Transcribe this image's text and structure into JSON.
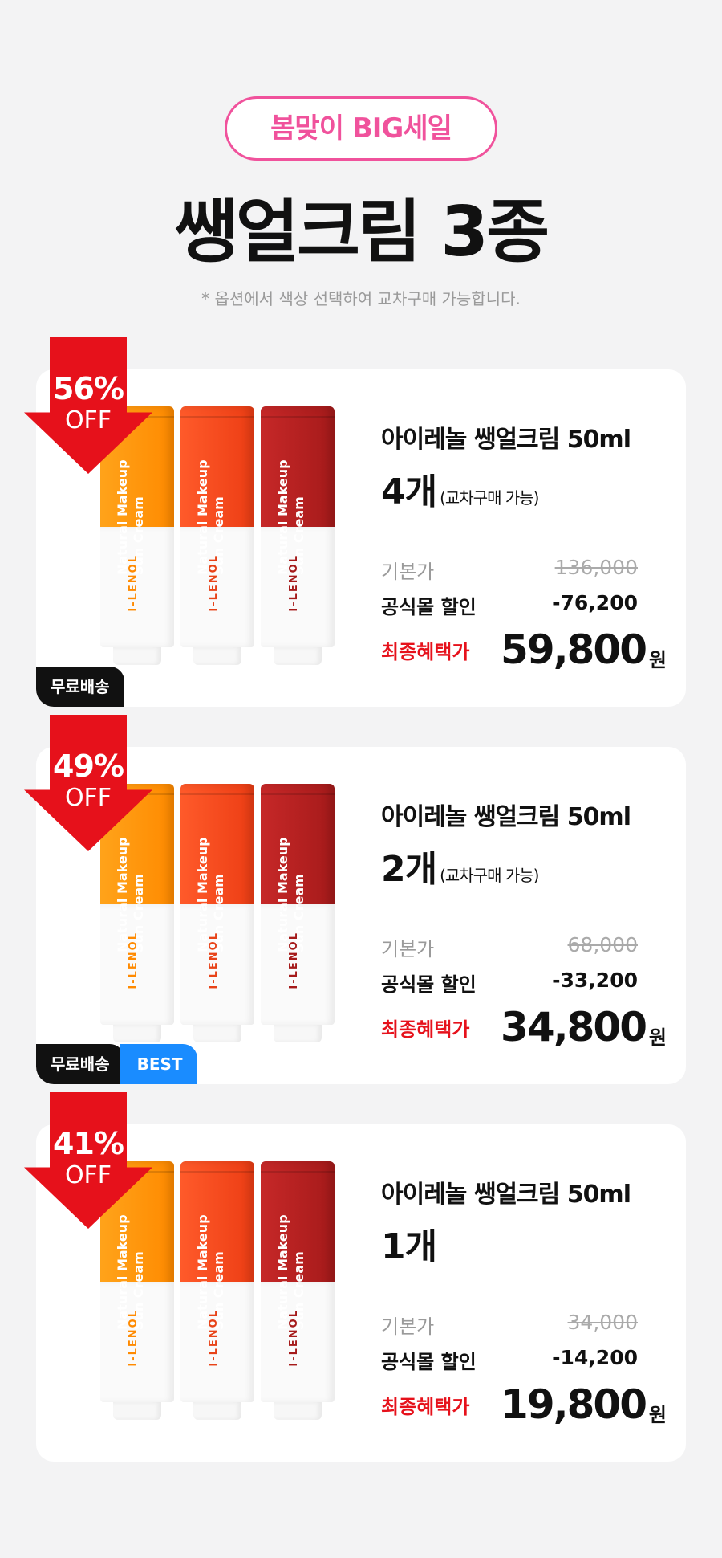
{
  "header": {
    "pill": "봄맞이 BIG세일",
    "headline": "쌩얼크림 3종",
    "note": "* 옵션에서 색상 선택하여 교차구매 가능합니다."
  },
  "tube_texts": {
    "label": "Natural Makeup Sun Cream",
    "brand": "I-LENOL"
  },
  "products": [
    {
      "discount_pct": "56%",
      "discount_off": "OFF",
      "tag_free": "무료배송",
      "tag_best": "",
      "name": "아이레놀 쌩얼크림 50ml",
      "qty": "4개",
      "qty_note": "(교차구매 가능)",
      "base_label": "기본가",
      "base_price": "136,000",
      "discount_label": "공식몰 할인",
      "discount_amount": "-76,200",
      "final_label": "최종혜택가",
      "final_price": "59,800",
      "unit": "원"
    },
    {
      "discount_pct": "49%",
      "discount_off": "OFF",
      "tag_free": "무료배송",
      "tag_best": "BEST",
      "name": "아이레놀 쌩얼크림 50ml",
      "qty": "2개",
      "qty_note": "(교차구매 가능)",
      "base_label": "기본가",
      "base_price": "68,000",
      "discount_label": "공식몰 할인",
      "discount_amount": "-33,200",
      "final_label": "최종혜택가",
      "final_price": "34,800",
      "unit": "원"
    },
    {
      "discount_pct": "41%",
      "discount_off": "OFF",
      "tag_free": "",
      "tag_best": "",
      "name": "아이레놀 쌩얼크림 50ml",
      "qty": "1개",
      "qty_note": "",
      "base_label": "기본가",
      "base_price": "34,000",
      "discount_label": "공식몰 할인",
      "discount_amount": "-14,200",
      "final_label": "최종혜택가",
      "final_price": "19,800",
      "unit": "원"
    }
  ],
  "colors": {
    "accent_pink": "#f0529c",
    "discount_red": "#e6111b",
    "best_blue": "#1a8cff",
    "tube_orange": "#ff8a00",
    "tube_red_orange": "#ec3d14",
    "tube_crimson": "#a51a1a"
  }
}
